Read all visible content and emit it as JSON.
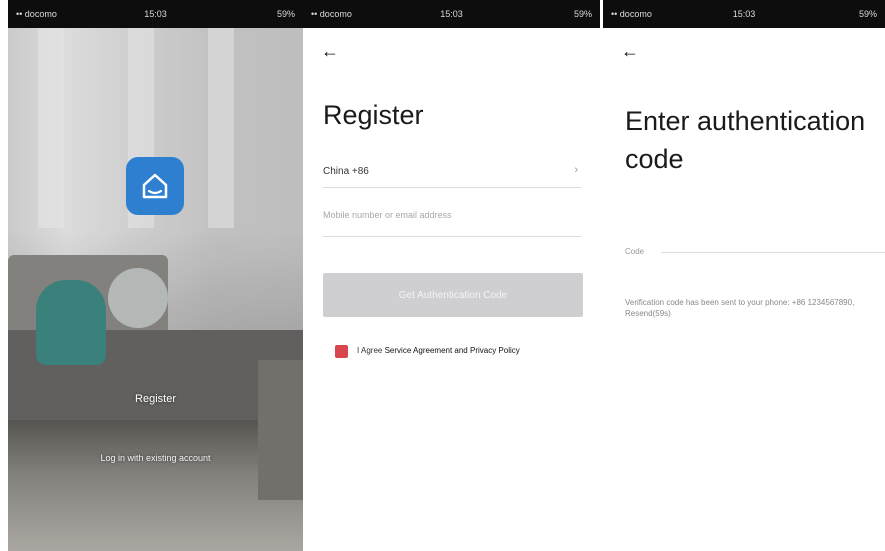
{
  "status_bar": {
    "carrier": "•• docomo",
    "time": "15:03",
    "battery": "59%"
  },
  "screen1": {
    "register_label": "Register",
    "login_label": "Log in with existing account"
  },
  "screen2": {
    "back_glyph": "←",
    "title": "Register",
    "country": "China +86",
    "chevron_glyph": "›",
    "phone_placeholder": "Mobile number or email address",
    "button_label": "Get Authentication Code",
    "agree_text": "I Agree",
    "agree_link": "Service Agreement and Privacy Policy"
  },
  "screen3": {
    "back_glyph": "←",
    "title": "Enter authentication code",
    "code_label": "Code",
    "description": "Verification code has been sent to your phone: +86 1234567890, Resend(59s)"
  },
  "colors": {
    "logo": "#2f7fd1",
    "checkbox": "#d8474d",
    "button_disabled": "#cfcfd2"
  }
}
